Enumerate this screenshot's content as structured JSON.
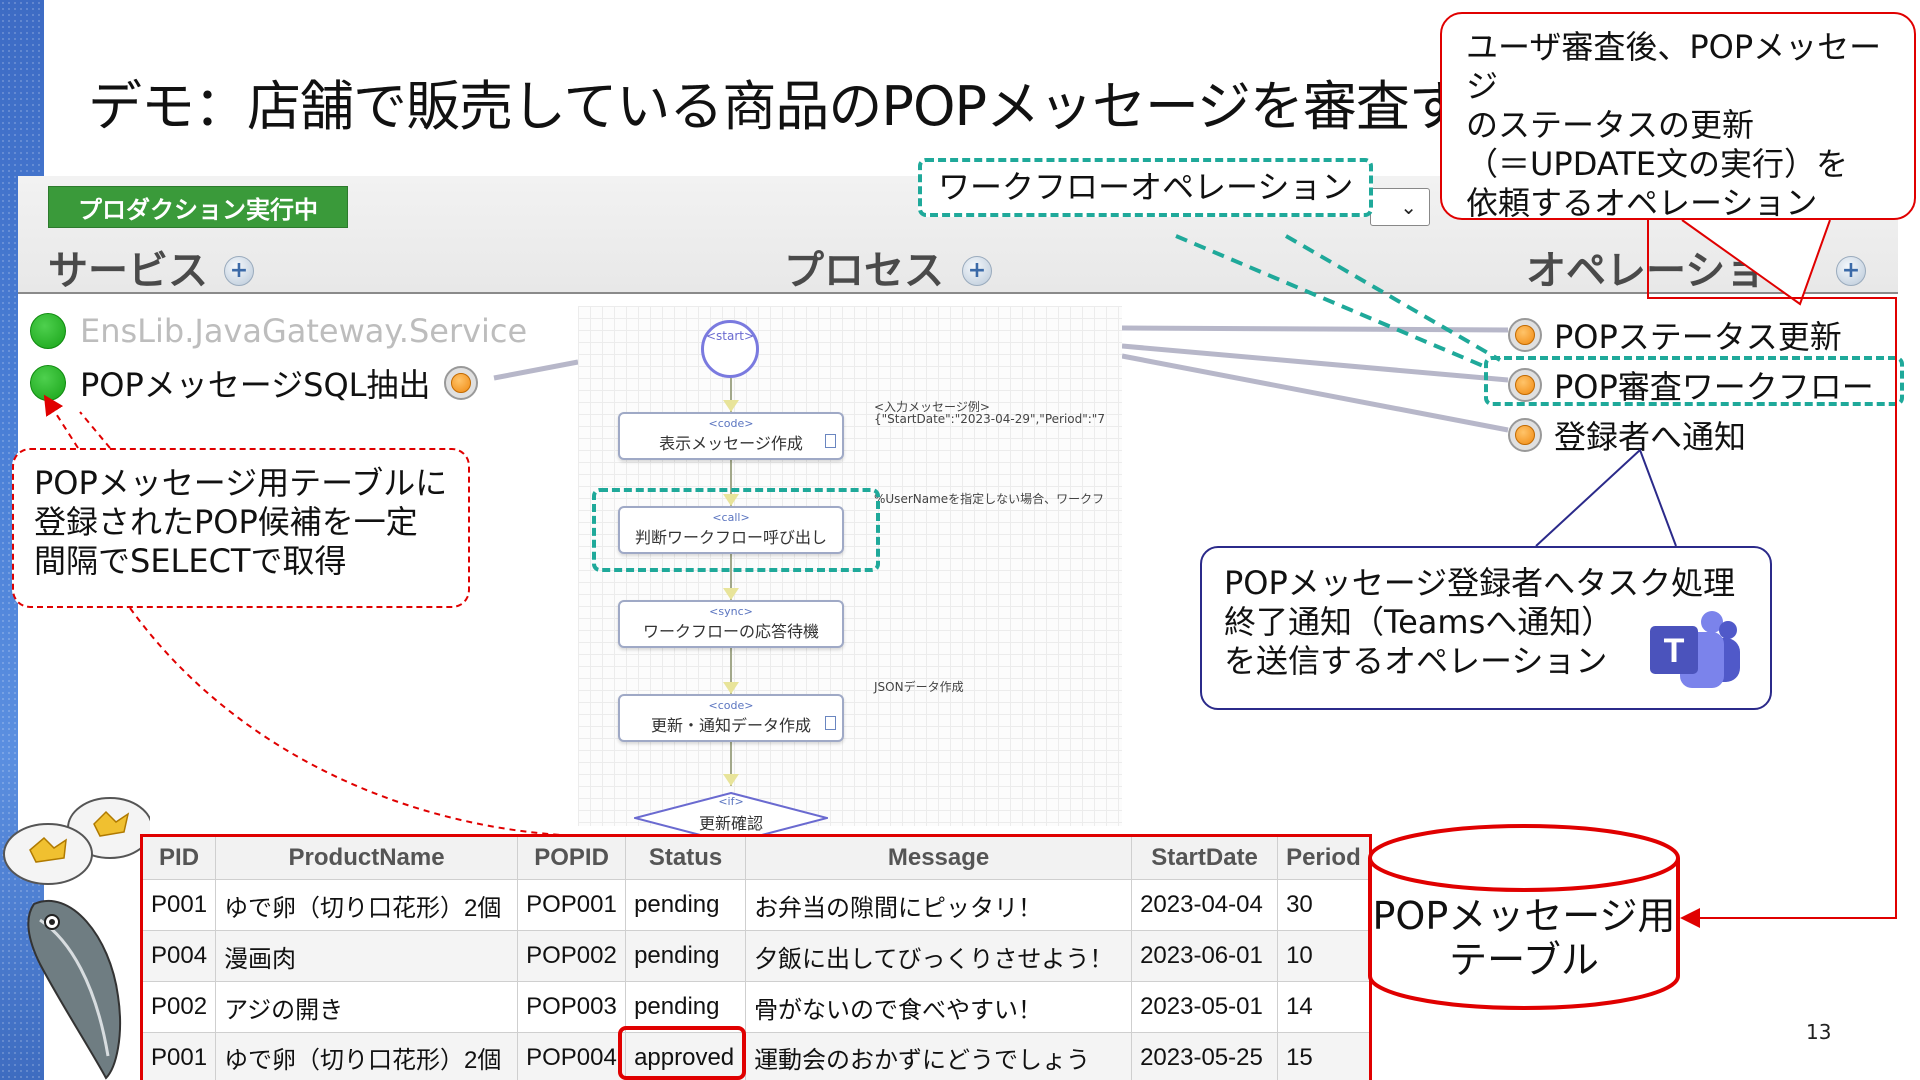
{
  "slide": {
    "title": "デモ：店舗で販売している商品のPOPメッセージを審査する",
    "page_number": "13"
  },
  "portal": {
    "status_badge": "プロダクション実行中",
    "columns": {
      "services": "サービス",
      "processes": "プロセス",
      "operations": "オペレーショ"
    },
    "plus_symbol": "+",
    "dropdown_arrow": "⌄",
    "services": [
      {
        "label": "EnsLib.JavaGateway.Service",
        "enabled": false
      },
      {
        "label": "POPメッセージSQL抽出",
        "enabled": true
      }
    ],
    "operations": [
      {
        "label": "POPステータス更新"
      },
      {
        "label": "POP審査ワークフロー"
      },
      {
        "label": "登録者へ通知"
      }
    ]
  },
  "bpl": {
    "start": "<start>",
    "steps": [
      {
        "kind": "<code>",
        "label": "表示メッセージ作成"
      },
      {
        "kind": "<call>",
        "label": "判断ワークフロー呼び出し"
      },
      {
        "kind": "<sync>",
        "label": "ワークフローの応答待機"
      },
      {
        "kind": "<code>",
        "label": "更新・通知データ作成"
      }
    ],
    "if_step": {
      "kind": "<if>",
      "label": "更新確認"
    },
    "notes": {
      "input_example_1": "<入力メッセージ例>",
      "input_example_2": "{\"StartDate\":\"2023-04-29\",\"Period\":\"7",
      "username_note": "%UserNameを指定しない場合、ワークフ",
      "json_note": "JSONデータ作成"
    }
  },
  "callouts": {
    "workflow_operation": "ワークフローオペレーション",
    "update_request_lines": [
      "ユーザ審査後、POPメッセージ",
      "のステータスの更新",
      "（＝UPDATE文の実行）を",
      "依頼するオペレーション"
    ],
    "select_lines": [
      "POPメッセージ用テーブルに",
      "登録されたPOP候補を一定",
      "間隔でSELECTで取得"
    ],
    "teams_lines": [
      "POPメッセージ登録者へタスク処理",
      "終了通知（Teamsへ通知）",
      "を送信するオペレーション"
    ],
    "db_lines": [
      "POPメッセージ用",
      "テーブル"
    ]
  },
  "table": {
    "headers": [
      "PID",
      "ProductName",
      "POPID",
      "Status",
      "Message",
      "StartDate",
      "Period"
    ],
    "rows": [
      [
        "P001",
        "ゆで卵（切り口花形）2個",
        "POP001",
        "pending",
        "お弁当の隙間にピッタリ！",
        "2023-04-04",
        "30"
      ],
      [
        "P004",
        "漫画肉",
        "POP002",
        "pending",
        "夕飯に出してびっくりさせよう！",
        "2023-06-01",
        "10"
      ],
      [
        "P002",
        "アジの開き",
        "POP003",
        "pending",
        "骨がないので食べやすい！",
        "2023-05-01",
        "14"
      ],
      [
        "P001",
        "ゆで卵（切り口花形）2個",
        "POP004",
        "approved",
        "運動会のおかずにどうでしょう",
        "2023-05-25",
        "15"
      ]
    ]
  },
  "icons": {
    "teams": "teams-logo-icon",
    "eggs": "boiled-egg-illustration",
    "fish": "horse-mackerel-illustration"
  },
  "colors": {
    "production_green": "#3a9a3a",
    "teal_highlight": "#1fa99a",
    "red_highlight": "#e00000",
    "navy_callout": "#2b2a8a",
    "port_orange": "#f08a12",
    "teams_purple": "#5b5fc7"
  }
}
